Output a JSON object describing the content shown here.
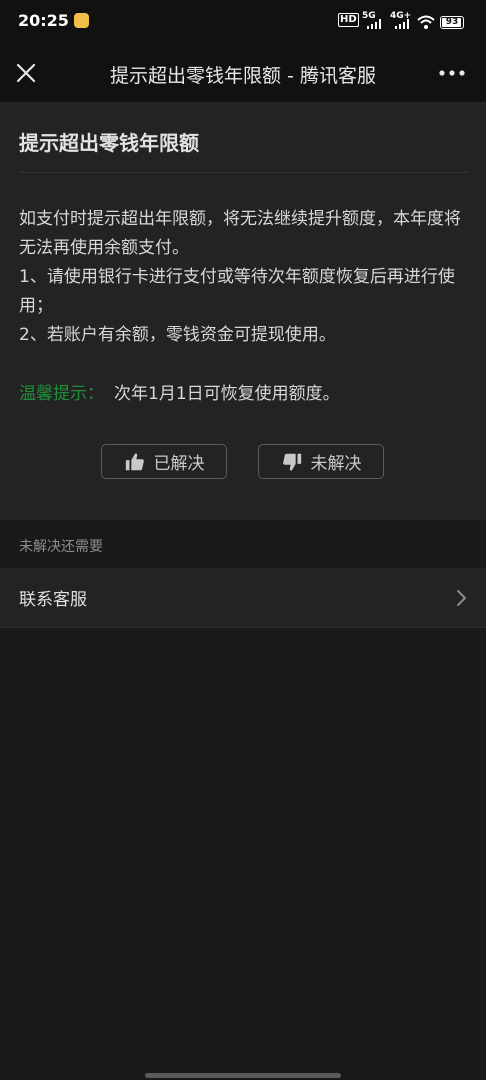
{
  "status_bar": {
    "time": "20:25",
    "hd_label": "HD",
    "network_1": "5G",
    "network_2": "4G+",
    "battery": "93"
  },
  "nav": {
    "title": "提示超出零钱年限额 - 腾讯客服",
    "close_icon": "close-icon",
    "more_icon": "more-icon"
  },
  "article": {
    "title": "提示超出零钱年限额",
    "paragraphs": [
      "如支付时提示超出年限额，将无法继续提升额度，本年度将无法再使用余额支付。",
      "1、请使用银行卡进行支付或等待次年额度恢复后再进行使用；",
      "2、若账户有余额，零钱资金可提现使用。"
    ],
    "tip_label": "温馨提示：",
    "tip_text": "次年1月1日可恢复使用额度。"
  },
  "feedback": {
    "solved_label": "已解决",
    "unsolved_label": "未解决"
  },
  "section": {
    "header": "未解决还需要"
  },
  "contact": {
    "label": "联系客服"
  },
  "colors": {
    "background": "#191919",
    "card": "#232323",
    "tip_green": "#1f8f3a",
    "nav_bar": "#111111"
  }
}
